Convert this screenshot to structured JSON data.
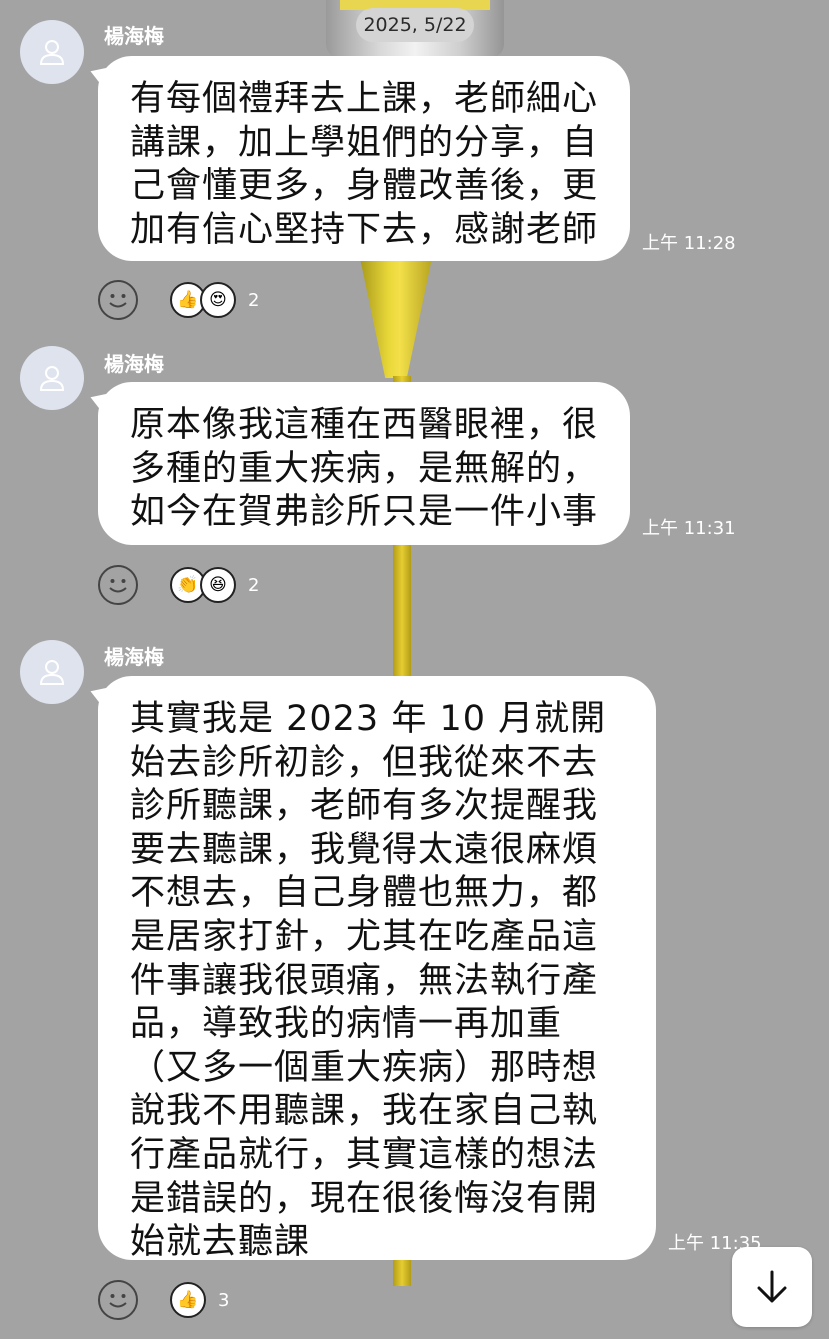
{
  "date_label": "2025, 5/22",
  "messages": [
    {
      "sender": "楊海梅",
      "text": "有每個禮拜去上課，老師細心講課，加上學姐們的分享，自己會懂更多，身體改善後，更加有信心堅持下去，感謝老師",
      "time": "上午 11:28",
      "reactions": {
        "icons": [
          "thumbs-up-sticker-icon",
          "heart-eyes-sticker-icon"
        ],
        "count": "2"
      }
    },
    {
      "sender": "楊海梅",
      "text": "原本像我這種在西醫眼裡，很多種的重大疾病，是無解的，如今在賀弗診所只是一件小事",
      "time": "上午 11:31",
      "reactions": {
        "icons": [
          "clap-sticker-icon",
          "laugh-sticker-icon"
        ],
        "count": "2"
      }
    },
    {
      "sender": "楊海梅",
      "text": "其實我是 2023 年 10 月就開始去診所初診，但我從來不去診所聽課，老師有多次提醒我要去聽課，我覺得太遠很麻煩不想去，自己身體也無力，都是居家打針，尤其在吃產品這件事讓我很頭痛，無法執行產品，導致我的病情一再加重（又多一個重大疾病）那時想說我不用聽課，我在家自己執行產品就行，其實這樣的想法是錯誤的，現在很後悔沒有開始就去聽課",
      "time": "上午 11:35",
      "reactions": {
        "icons": [
          "thumbs-up-sticker-icon"
        ],
        "count": "3"
      }
    }
  ],
  "colors": {
    "background": "#a3a3a3",
    "bubble": "#ffffff",
    "avatar": "#dfe3ee",
    "stream": "#e9cf2b"
  },
  "icons": {
    "avatar": "person-icon",
    "react_button": "smiley-icon",
    "scroll": "arrow-down-icon"
  }
}
